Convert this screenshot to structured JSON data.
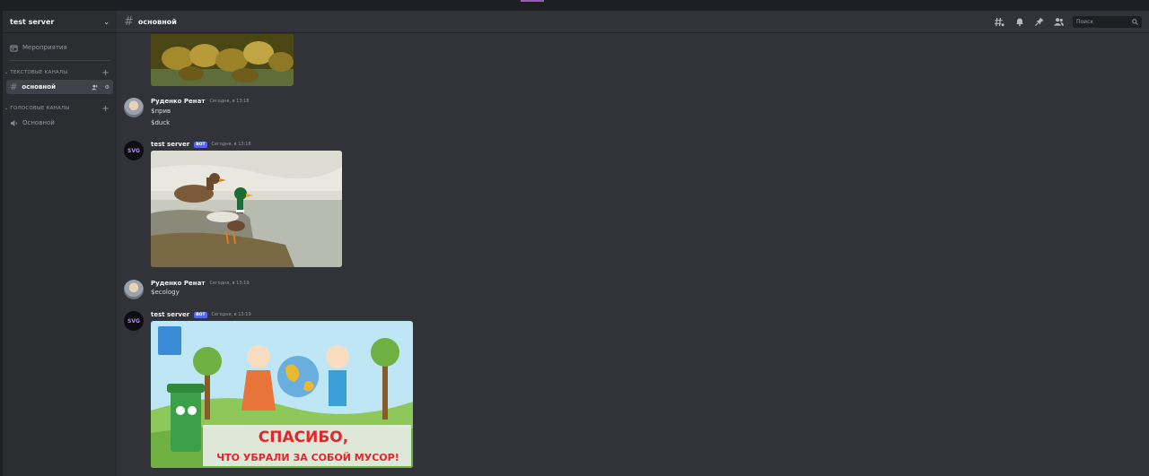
{
  "server": {
    "name": "test server"
  },
  "sidebar": {
    "events_label": "Мероприятия",
    "categories": [
      {
        "label": "ТЕКСТОВЫЕ КАНАЛЫ",
        "channels": [
          {
            "name": "основной",
            "active": true
          }
        ]
      },
      {
        "label": "ГОЛОСОВЫЕ КАНАЛЫ",
        "channels": [
          {
            "name": "Основной",
            "active": false
          }
        ]
      }
    ]
  },
  "header": {
    "channel_name": "основной",
    "search_placeholder": "Поиск",
    "icons": [
      "threads-icon",
      "bell-icon",
      "pin-icon",
      "members-icon",
      "search-icon"
    ]
  },
  "messages": [
    {
      "author": "Руденко Ренат",
      "bot": false,
      "time": "Сегодня, в 13:18",
      "lines": [
        "$прив",
        "$duck"
      ]
    },
    {
      "author": "test server",
      "bot": true,
      "badge": "BOT",
      "time": "Сегодня, в 13:18",
      "image": "ducks-photo"
    },
    {
      "author": "Руденко Ренат",
      "bot": false,
      "time": "Сегодня, в 13:19",
      "lines": [
        "$ecology"
      ]
    },
    {
      "author": "test server",
      "bot": true,
      "badge": "BOT",
      "time": "Сегодня, в 13:19",
      "image": "ecology-poster"
    }
  ],
  "poster": {
    "line1": "СПАСИБО,",
    "line2": "ЧТО УБРАЛИ ЗА СОБОЙ МУСОР!"
  },
  "colors": {
    "accent": "#5865f2",
    "sidebar": "#2b2d31",
    "chat": "#313338"
  }
}
